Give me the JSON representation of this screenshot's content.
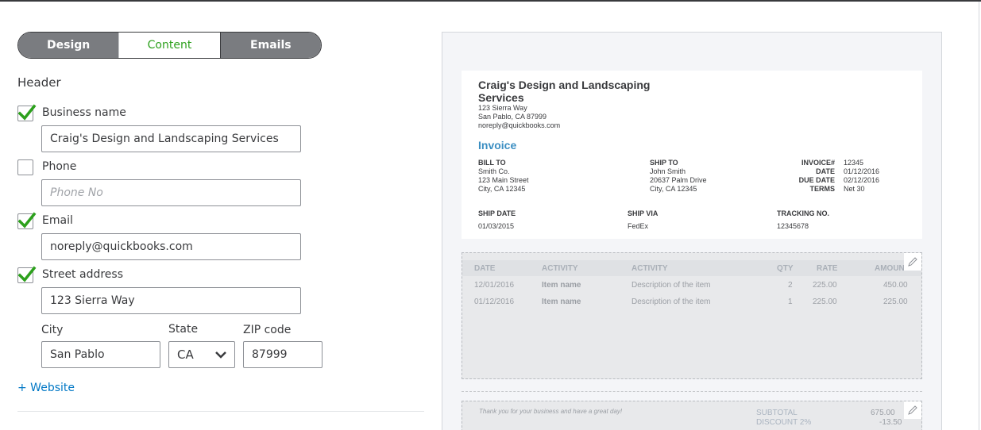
{
  "tabs": {
    "design": "Design",
    "content": "Content",
    "emails": "Emails"
  },
  "section_title": "Header",
  "business_name": {
    "label": "Business name",
    "checked": true,
    "value": "Craig's Design and Landscaping Services"
  },
  "phone": {
    "label": "Phone",
    "checked": false,
    "placeholder": "Phone No"
  },
  "email": {
    "label": "Email",
    "checked": true,
    "value": "noreply@quickbooks.com"
  },
  "street": {
    "label": "Street address",
    "checked": true,
    "value": "123 Sierra Way"
  },
  "city": {
    "label": "City",
    "value": "San Pablo"
  },
  "state": {
    "label": "State",
    "value": "CA"
  },
  "zip": {
    "label": "ZIP code",
    "value": "87999"
  },
  "website_link": "+ Website",
  "preview": {
    "company_line1": "Craig's Design and Landscaping",
    "company_line2": "Services",
    "address1": "123 Sierra Way",
    "address2": "San Pablo, CA 87999",
    "email": "noreply@quickbooks.com",
    "invoice_title": "Invoice",
    "bill_to": {
      "label": "BILL TO",
      "line1": "Smith Co.",
      "line2": "123 Main Street",
      "line3": "City, CA 12345"
    },
    "ship_to": {
      "label": "SHIP TO",
      "line1": "John Smith",
      "line2": "20637 Palm Drive",
      "line3": "City, CA 12345"
    },
    "meta": {
      "invoice_label": "INVOICE#",
      "invoice_value": "12345",
      "date_label": "DATE",
      "date_value": "01/12/2016",
      "due_label": "DUE DATE",
      "due_value": "02/12/2016",
      "terms_label": "TERMS",
      "terms_value": "Net 30"
    },
    "ship": {
      "date_label": "SHIP DATE",
      "date_value": "01/03/2015",
      "via_label": "SHIP VIA",
      "via_value": "FedEx",
      "tracking_label": "TRACKING NO.",
      "tracking_value": "12345678"
    },
    "table": {
      "headers": [
        "DATE",
        "ACTIVITY",
        "ACTIVITY",
        "QTY",
        "RATE",
        "AMOUNT"
      ],
      "rows": [
        [
          "12/01/2016",
          "Item name",
          "Description of the item",
          "2",
          "225.00",
          "450.00"
        ],
        [
          "01/12/2016",
          "Item name",
          "Description of the item",
          "1",
          "225.00",
          "225.00"
        ]
      ]
    },
    "footer": {
      "thanks": "Thank you for your business and have a great day!",
      "subtotal_label": "SUBTOTAL",
      "subtotal_value": "675.00",
      "discount_label": "DISCOUNT 2%",
      "discount_value": "-13.50"
    }
  }
}
